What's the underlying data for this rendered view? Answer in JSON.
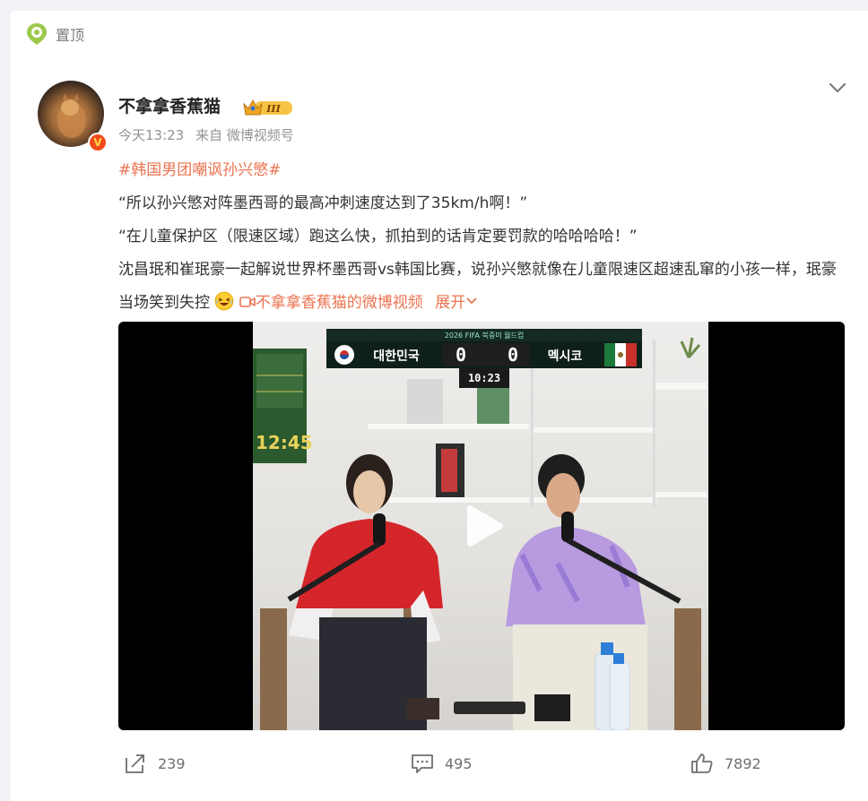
{
  "pinned_label": "置顶",
  "author": {
    "name": "不拿拿香蕉猫",
    "badge_level": "III"
  },
  "meta": {
    "time": "今天13:23",
    "source": "来自 微博视频号"
  },
  "post": {
    "hashtag": "#韩国男团嘲讽孙兴慜#",
    "line1": "“所以孙兴慜对阵墨西哥的最高冲刺速度达到了35km/h啊！”",
    "line2": "“在儿童保护区（限速区域）跑这么快，抓拍到的话肯定要罚款的哈哈哈哈！”",
    "line3": "沈昌珉和崔珉豪一起解说世界杯墨西哥vs韩国比赛，说孙兴慜就像在儿童限速区超速乱窜的小孩一样，珉豪当场笑到失控",
    "video_link": "不拿拿香蕉猫的微博视频",
    "expand": "展开"
  },
  "video": {
    "scoreboard": {
      "header": "2026 FIFA 북중미 월드컵",
      "team_left": "대한민국",
      "team_right": "멕시코",
      "score_left": "0",
      "score_right": "0",
      "clock": "10 : 23",
      "sub_time": "10:23"
    },
    "wall_clock": "12:45"
  },
  "actions": {
    "repost_count": "239",
    "comment_count": "495",
    "like_count": "7892"
  },
  "colors": {
    "accent": "#eb7350",
    "link_orange": "#eb7350",
    "background": "#f1f2f5"
  },
  "icons": [
    "pin-icon",
    "chevron-down-icon",
    "crown-badge-icon",
    "verified-v-icon",
    "laughing-emoji-icon",
    "video-camera-icon",
    "play-icon",
    "repost-icon",
    "comment-icon",
    "like-icon"
  ]
}
